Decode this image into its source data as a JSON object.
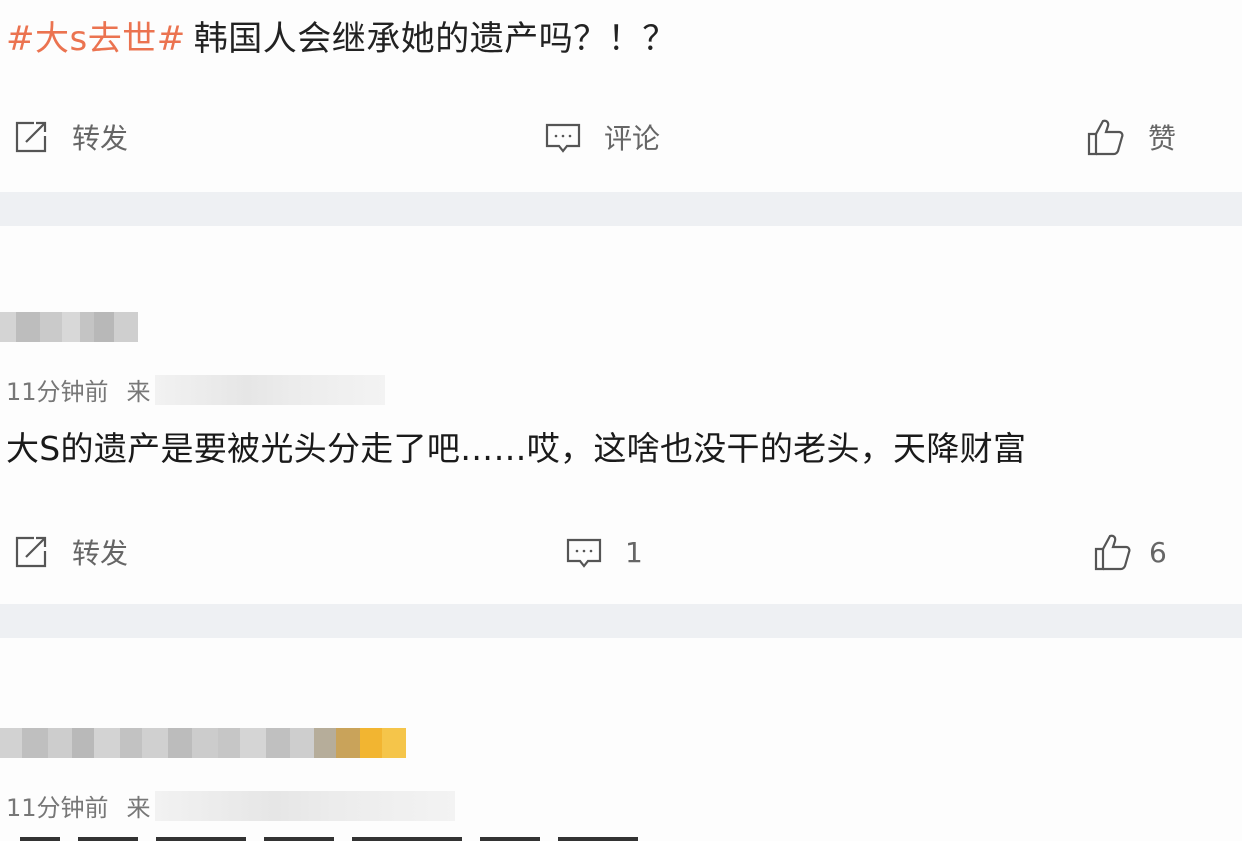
{
  "post": {
    "hashtag": "#大s去世#",
    "text": "韩国人会继承她的遗产吗？！？",
    "actions": {
      "repost_label": "转发",
      "comment_label": "评论",
      "like_label": "赞"
    }
  },
  "comments": [
    {
      "time": "11分钟前",
      "source_prefix": "来",
      "text": "大S的遗产是要被光头分走了吧……哎，这啥也没干的老头，天降财富",
      "actions": {
        "repost_label": "转发",
        "comment_count": "1",
        "like_count": "6"
      }
    },
    {
      "time": "11分钟前",
      "source_prefix": "来"
    }
  ],
  "colors": {
    "hashtag": "#eb7350",
    "divider": "#eef0f3",
    "icon": "#555555"
  },
  "icons": [
    "repost-icon",
    "comment-icon",
    "like-icon"
  ]
}
